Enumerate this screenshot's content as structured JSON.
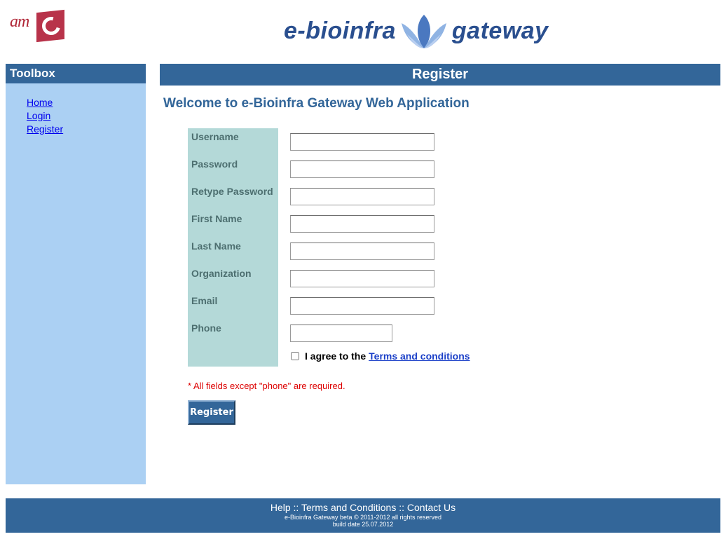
{
  "header": {
    "amc_logo_text": "am",
    "brand_left": "e-bioinfra",
    "brand_right": "gateway"
  },
  "sidebar": {
    "title": "Toolbox",
    "links": [
      "Home",
      "Login",
      "Register"
    ]
  },
  "main": {
    "bar_title": "Register",
    "welcome": "Welcome to e-Bioinfra Gateway Web Application"
  },
  "form": {
    "fields": [
      {
        "label": "Username",
        "value": ""
      },
      {
        "label": "Password",
        "value": ""
      },
      {
        "label": "Retype Password",
        "value": ""
      },
      {
        "label": "First Name",
        "value": ""
      },
      {
        "label": "Last Name",
        "value": ""
      },
      {
        "label": "Organization",
        "value": ""
      },
      {
        "label": "Email",
        "value": ""
      },
      {
        "label": "Phone",
        "value": ""
      }
    ],
    "agree_text": "I agree to the",
    "terms_link": "Terms and conditions ",
    "agree_checked": false,
    "required_note": "* All fields except \"phone\" are required.",
    "submit_label": "Register"
  },
  "footer": {
    "help": "Help",
    "separator": " :: ",
    "terms": "Terms and Conditions",
    "contact": "Contact Us",
    "copyright": "e-Bioinfra Gateway beta © 2011-2012 all rights reserved",
    "build": "build date 25.07.2012"
  },
  "colors": {
    "accent": "#336699",
    "sidebar_bg": "#abd0f3",
    "label_panel": "#b4d9d8",
    "required": "#dd0000",
    "amc_red": "#b8334a"
  }
}
